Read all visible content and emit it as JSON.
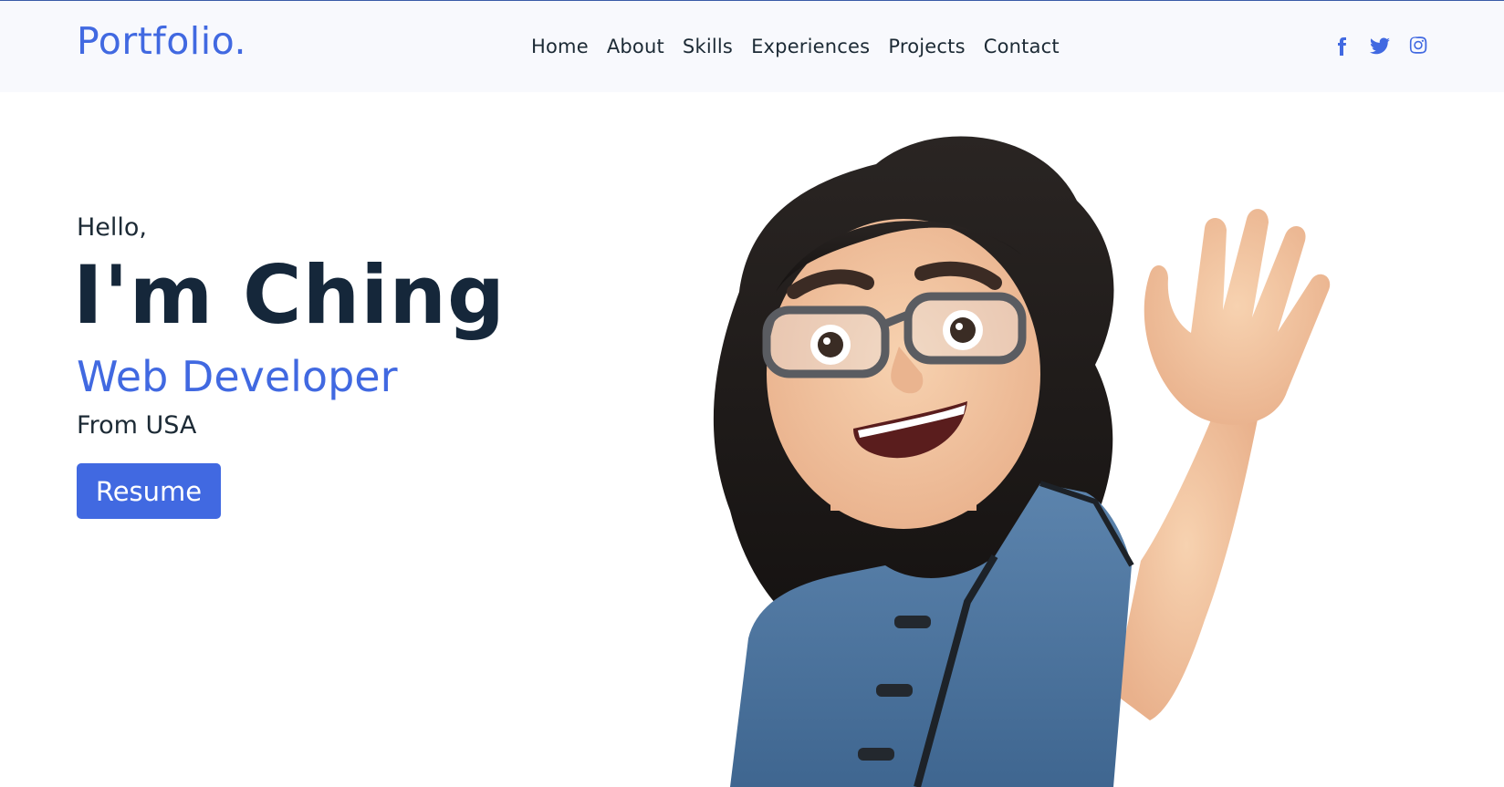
{
  "navbar": {
    "brand": "Portfolio.",
    "links": [
      "Home",
      "About",
      "Skills",
      "Experiences",
      "Projects",
      "Contact"
    ],
    "socials": [
      "facebook-icon",
      "twitter-icon",
      "instagram-icon"
    ]
  },
  "hero": {
    "greeting": "Hello,",
    "name": "I'm Ching",
    "role": "Web Developer",
    "location": "From USA",
    "resume_label": "Resume"
  },
  "colors": {
    "accent": "#4169e1",
    "text_dark": "#15273a",
    "navbar_bg": "#f8f9fd"
  }
}
